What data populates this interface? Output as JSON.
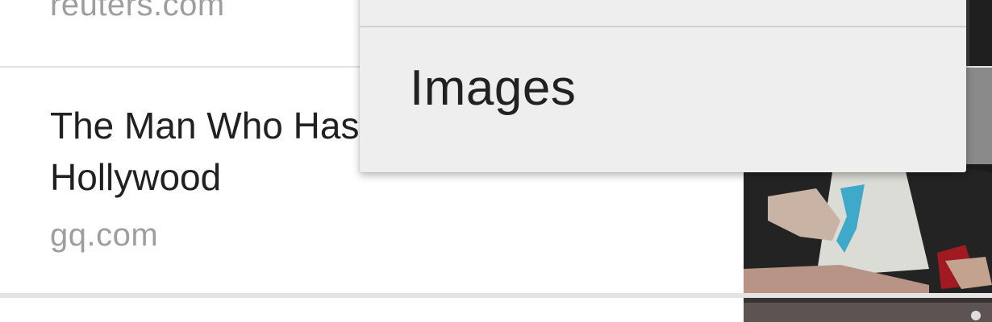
{
  "news_list": {
    "items": [
      {
        "headline": "",
        "source": "reuters.com"
      },
      {
        "headline": "The Man Who Has All of\nHollywood",
        "source": "gq.com"
      },
      {
        "headline": "",
        "source": ""
      }
    ]
  },
  "overflow_menu": {
    "items": [
      {
        "label": ""
      },
      {
        "label": "Images"
      }
    ]
  },
  "colors": {
    "menu_background": "#eeeeee",
    "headline_text": "#212121",
    "source_text": "#9e9e9e",
    "divider": "#e2e2e2"
  }
}
